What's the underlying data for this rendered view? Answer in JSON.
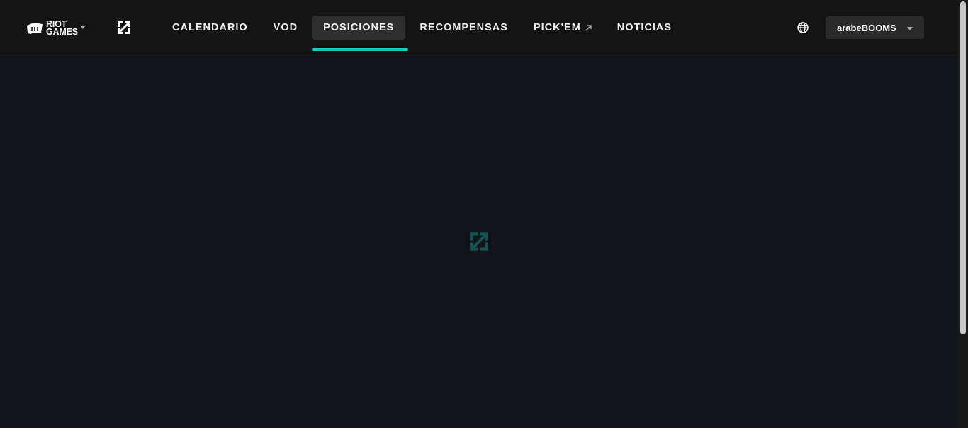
{
  "header": {
    "riot_logo_line1": "RIOT",
    "riot_logo_line2": "GAMES",
    "nav": [
      {
        "label": "CALENDARIO"
      },
      {
        "label": "VOD"
      },
      {
        "label": "POSICIONES",
        "active": true
      },
      {
        "label": "RECOMPENSAS"
      },
      {
        "label": "PICK'EM",
        "external": true
      },
      {
        "label": "NOTICIAS"
      }
    ],
    "user": {
      "name": "arabeBOOMS"
    }
  },
  "icons": {
    "logo": "riot-games-logo",
    "game": "league-of-legends-icon",
    "language": "globe-icon",
    "external": "external-link-arrow-icon",
    "loading": "loading-icon"
  },
  "colors": {
    "accent": "#1bc6c0",
    "header_bg": "#141414",
    "page_bg": "#111519",
    "active_tab_bg": "#2e2e2e"
  }
}
